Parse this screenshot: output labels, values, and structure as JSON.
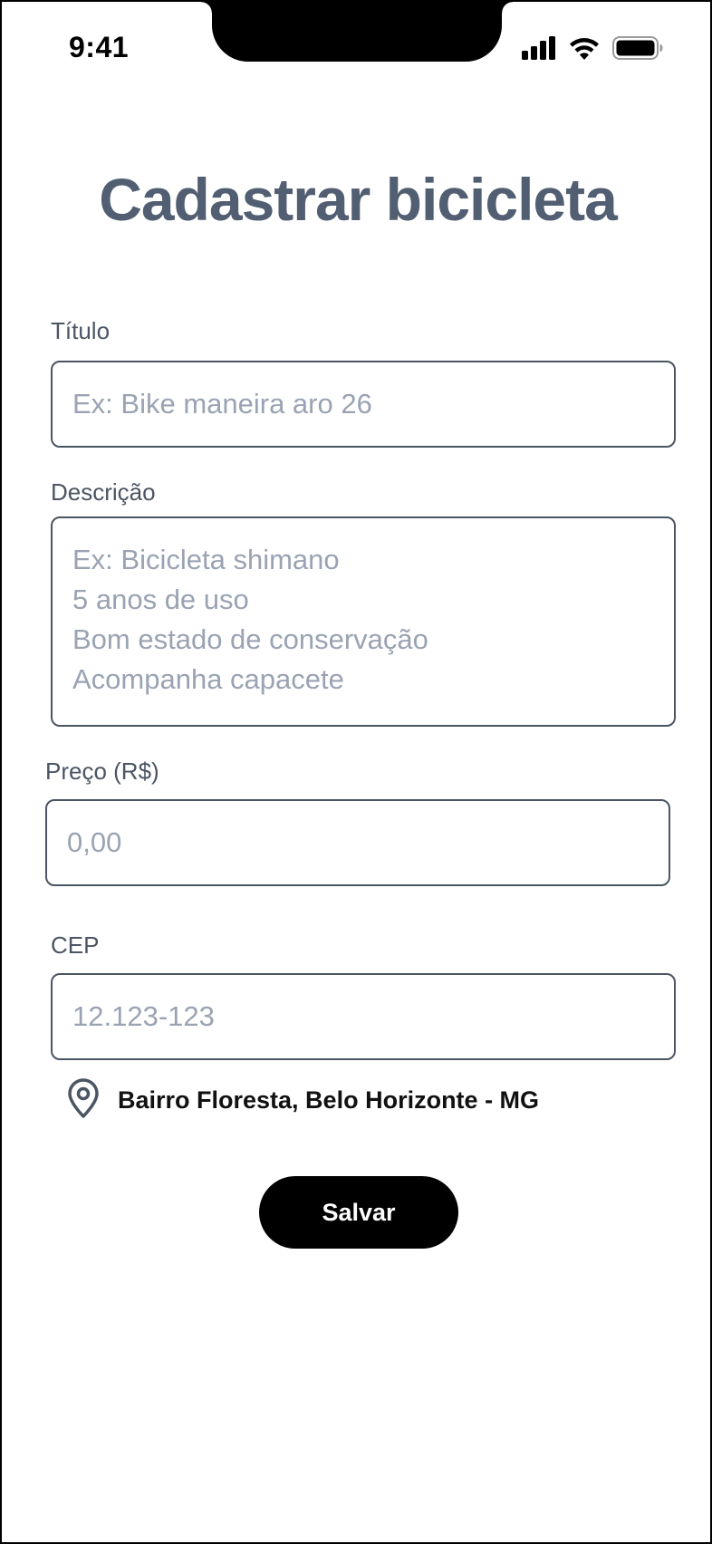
{
  "status_bar": {
    "time": "9:41",
    "icons": [
      "cellular-signal-icon",
      "wifi-icon",
      "battery-icon"
    ]
  },
  "page": {
    "title": "Cadastrar bicicleta"
  },
  "form": {
    "title_field": {
      "label": "Título",
      "placeholder": "Ex: Bike maneira aro 26",
      "value": ""
    },
    "description_field": {
      "label": "Descrição",
      "placeholder": "Ex: Bicicleta shimano\n5 anos de uso\nBom estado de conservação\nAcompanha capacete",
      "value": ""
    },
    "price_field": {
      "label": "Preço (R$)",
      "placeholder": "0,00",
      "value": ""
    },
    "cep_field": {
      "label": "CEP",
      "placeholder": "12.123-123",
      "value": ""
    },
    "location": {
      "icon": "map-pin-icon",
      "text": "Bairro Floresta, Belo Horizonte - MG"
    },
    "save_label": "Salvar"
  },
  "colors": {
    "title": "#525e72",
    "label": "#4b5563",
    "border": "#4b5563",
    "placeholder": "#9aa3b3",
    "button_bg": "#000000",
    "button_text": "#ffffff"
  }
}
